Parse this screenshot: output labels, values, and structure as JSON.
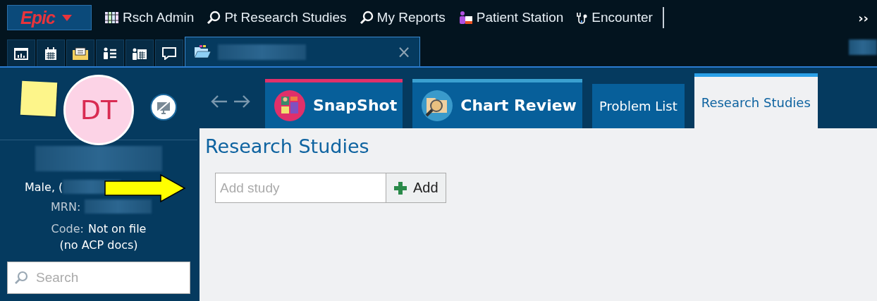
{
  "toolbar": {
    "menu_label": "Epic",
    "items": [
      {
        "label": "Rsch Admin",
        "kind": "books"
      },
      {
        "label": "Pt Research Studies",
        "kind": "search"
      },
      {
        "label": "My Reports",
        "kind": "search"
      },
      {
        "label": "Patient Station",
        "kind": "people"
      },
      {
        "label": "Encounter",
        "kind": "stethoscope"
      }
    ],
    "overflow": "››"
  },
  "activities": [
    {
      "kind": "report",
      "selected": false
    },
    {
      "kind": "calendar",
      "selected": false
    },
    {
      "kind": "inbox",
      "selected": false
    },
    {
      "kind": "list",
      "selected": false
    },
    {
      "kind": "schedule",
      "selected": false
    },
    {
      "kind": "chat",
      "selected": false
    },
    {
      "kind": "folder",
      "selected": true,
      "close": "×"
    }
  ],
  "patient": {
    "initials": "DT",
    "sex": "Male, (",
    "mrn_label": "MRN:",
    "code_label": "Code:",
    "code_value": "Not on file",
    "acp": "(no ACP docs)"
  },
  "search": {
    "placeholder": "Search"
  },
  "tabs": [
    {
      "label": "SnapShot",
      "kind": "snapshot",
      "color": "#e0306a",
      "selected": false
    },
    {
      "label": "Chart Review",
      "kind": "chart-review",
      "color": "#3aa0d0",
      "selected": false
    },
    {
      "label": "Problem List",
      "kind": "plain",
      "selected": false
    },
    {
      "label": "Research Studies",
      "kind": "plain",
      "color": "#2aa0e8",
      "selected": true
    }
  ],
  "section": {
    "title": "Research Studies",
    "field": {
      "placeholder": "Add study"
    },
    "add_button": "Add"
  }
}
